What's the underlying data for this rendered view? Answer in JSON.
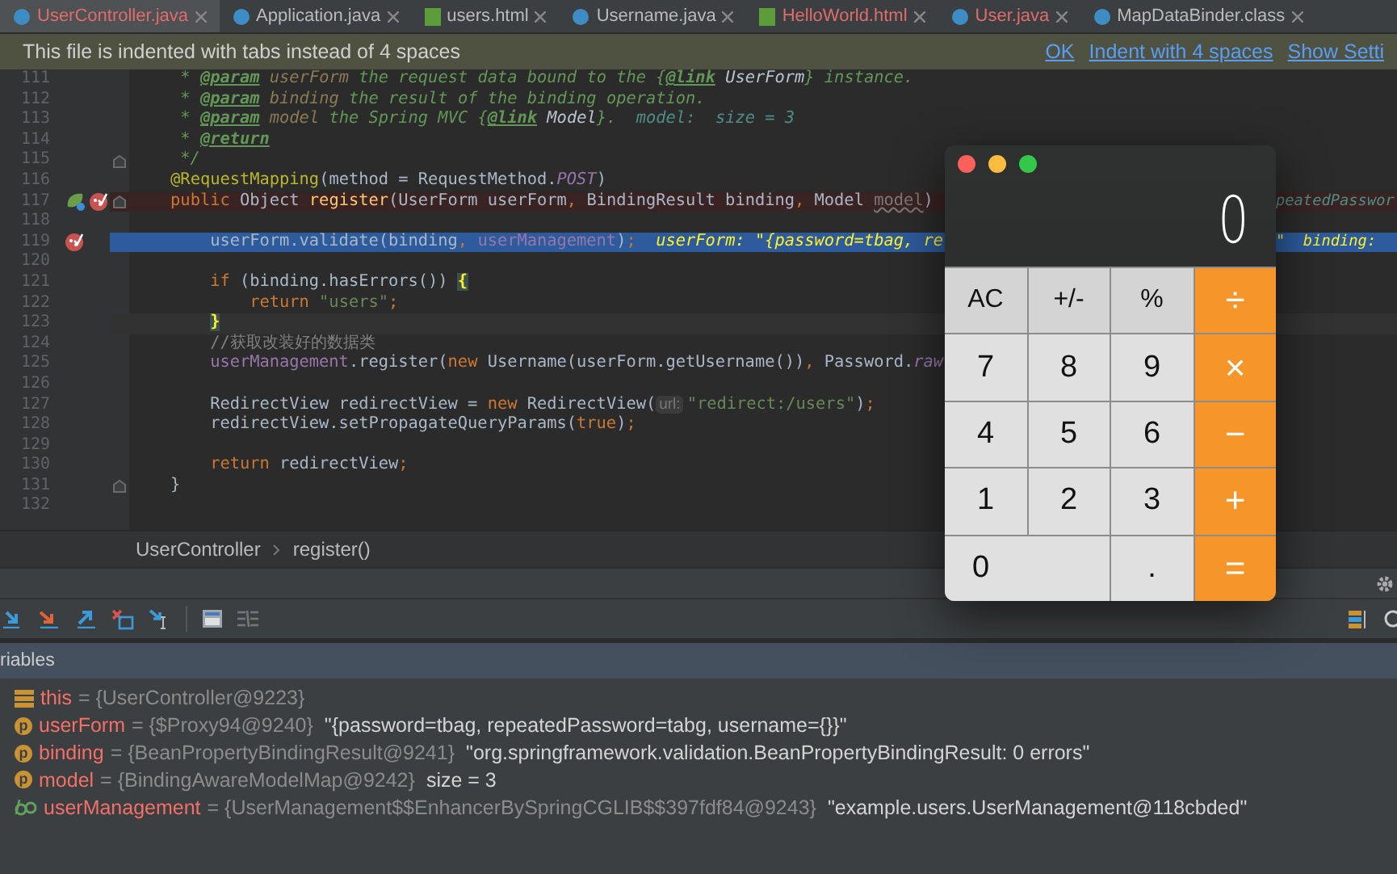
{
  "tabs": [
    {
      "label": "UserController.java",
      "kind": "class",
      "error": true,
      "selected": true
    },
    {
      "label": "Application.java",
      "kind": "class",
      "error": false,
      "selected": false
    },
    {
      "label": "users.html",
      "kind": "html",
      "error": false,
      "selected": false
    },
    {
      "label": "Username.java",
      "kind": "class",
      "error": false,
      "selected": false
    },
    {
      "label": "HelloWorld.html",
      "kind": "html",
      "error": true,
      "selected": false
    },
    {
      "label": "User.java",
      "kind": "class",
      "error": true,
      "selected": false
    },
    {
      "label": "MapDataBinder.class",
      "kind": "class",
      "error": false,
      "selected": false
    }
  ],
  "notification": {
    "message": "This file is indented with tabs instead of 4 spaces",
    "links": [
      "OK",
      "Indent with 4 spaces",
      "Show Setti"
    ]
  },
  "editor": {
    "lines": [
      {
        "number": "111",
        "kind": "plain",
        "tokens": [
          {
            "text": "     * ",
            "kind": "doc"
          },
          {
            "text": "@param",
            "kind": "doctag"
          },
          {
            "text": " userForm",
            "kind": "docparam"
          },
          {
            "text": " the request data bound to the {",
            "kind": "doc"
          },
          {
            "text": "@link",
            "kind": "doctag"
          },
          {
            "text": " UserForm",
            "kind": "docref"
          },
          {
            "text": "} instance.",
            "kind": "doc"
          }
        ]
      },
      {
        "number": "112",
        "kind": "plain",
        "tokens": [
          {
            "text": "     * ",
            "kind": "doc"
          },
          {
            "text": "@param",
            "kind": "doctag"
          },
          {
            "text": " binding",
            "kind": "docparam"
          },
          {
            "text": " the result of the binding operation.",
            "kind": "doc"
          }
        ]
      },
      {
        "number": "113",
        "kind": "plain",
        "tokens": [
          {
            "text": "     * ",
            "kind": "doc"
          },
          {
            "text": "@param",
            "kind": "doctag"
          },
          {
            "text": " model",
            "kind": "docparam"
          },
          {
            "text": " the Spring MVC {",
            "kind": "doc"
          },
          {
            "text": "@link",
            "kind": "doctag"
          },
          {
            "text": " Model",
            "kind": "docref"
          },
          {
            "text": "}.",
            "kind": "doc"
          },
          {
            "text": "  model:  size = 3",
            "kind": "hint"
          }
        ]
      },
      {
        "number": "114",
        "kind": "plain",
        "tokens": [
          {
            "text": "     * ",
            "kind": "doc"
          },
          {
            "text": "@return",
            "kind": "doctag"
          }
        ]
      },
      {
        "number": "115",
        "kind": "plain",
        "gutter": [
          {
            "kind": "fold"
          }
        ],
        "tokens": [
          {
            "text": "     */",
            "kind": "doc"
          }
        ]
      },
      {
        "number": "116",
        "kind": "plain",
        "tokens": [
          {
            "text": "    @RequestMapping",
            "kind": "ann"
          },
          {
            "text": "(method = RequestMethod.",
            "kind": "plain"
          },
          {
            "text": "POST",
            "kind": "const"
          },
          {
            "text": ")",
            "kind": "plain"
          }
        ]
      },
      {
        "number": "117",
        "kind": "breakpoint",
        "gutter": [
          {
            "kind": "bean"
          },
          {
            "kind": "breakpoint"
          },
          {
            "kind": "fold"
          }
        ],
        "tokens": [
          {
            "text": "    public ",
            "kind": "kw"
          },
          {
            "text": "Object ",
            "kind": "plain"
          },
          {
            "text": "register",
            "kind": "method"
          },
          {
            "text": "(UserForm userForm",
            "kind": "plain"
          },
          {
            "text": ", ",
            "kind": "kw"
          },
          {
            "text": "BindingResult binding",
            "kind": "plain"
          },
          {
            "text": ", ",
            "kind": "kw"
          },
          {
            "text": "Model ",
            "kind": "plain"
          },
          {
            "text": "model",
            "kind": "unused"
          },
          {
            "text": ")",
            "kind": "plain"
          }
        ],
        "right": [
          {
            "text": "peatedPasswor",
            "kind": "hint"
          }
        ]
      },
      {
        "number": "118",
        "kind": "plain"
      },
      {
        "number": "119",
        "kind": "execution",
        "gutter": [
          {
            "kind": "breakpoint"
          }
        ],
        "tokens": [
          {
            "text": "        userForm.validate(binding",
            "kind": "plain"
          },
          {
            "text": ", ",
            "kind": "kw"
          },
          {
            "text": "userManagement",
            "kind": "field"
          },
          {
            "text": ")",
            "kind": "plain"
          },
          {
            "text": ";",
            "kind": "kw"
          },
          {
            "text": "  userForm: \"{password=tbag, re",
            "kind": "debughint"
          }
        ],
        "right": [
          {
            "text": "\"  binding: ",
            "kind": "debughint"
          }
        ]
      },
      {
        "number": "120",
        "kind": "plain"
      },
      {
        "number": "121",
        "kind": "plain",
        "tokens": [
          {
            "text": "        if ",
            "kind": "kw"
          },
          {
            "text": "(binding.hasErrors()) ",
            "kind": "plain"
          },
          {
            "text": "{",
            "kind": "brace"
          }
        ]
      },
      {
        "number": "122",
        "kind": "plain",
        "tokens": [
          {
            "text": "            return ",
            "kind": "kw"
          },
          {
            "text": "\"users\"",
            "kind": "str"
          },
          {
            "text": ";",
            "kind": "kw"
          }
        ]
      },
      {
        "number": "123",
        "kind": "caret",
        "tokens": [
          {
            "text": "        }",
            "kind": "brace"
          }
        ]
      },
      {
        "number": "124",
        "kind": "plain",
        "tokens": [
          {
            "text": "        //获取改装好的数据类",
            "kind": "comment"
          }
        ]
      },
      {
        "number": "125",
        "kind": "plain",
        "tokens": [
          {
            "text": "        userManagement",
            "kind": "field"
          },
          {
            "text": ".register(",
            "kind": "plain"
          },
          {
            "text": "new ",
            "kind": "kw"
          },
          {
            "text": "Username(userForm.getUsername())",
            "kind": "plain"
          },
          {
            "text": ", ",
            "kind": "kw"
          },
          {
            "text": "Password.",
            "kind": "plain"
          },
          {
            "text": "raw",
            "kind": "const"
          }
        ]
      },
      {
        "number": "126",
        "kind": "plain"
      },
      {
        "number": "127",
        "kind": "plain",
        "tokens": [
          {
            "text": "        RedirectView redirectView = ",
            "kind": "plain"
          },
          {
            "text": "new ",
            "kind": "kw"
          },
          {
            "text": "RedirectView(",
            "kind": "plain"
          },
          {
            "text": "url:",
            "kind": "paramhint"
          },
          {
            "text": "\"redirect:/users\"",
            "kind": "str"
          },
          {
            "text": ")",
            "kind": "plain"
          },
          {
            "text": ";",
            "kind": "kw"
          }
        ]
      },
      {
        "number": "128",
        "kind": "plain",
        "tokens": [
          {
            "text": "        redirectView.setPropagateQueryParams(",
            "kind": "plain"
          },
          {
            "text": "true",
            "kind": "kw"
          },
          {
            "text": ")",
            "kind": "plain"
          },
          {
            "text": ";",
            "kind": "kw"
          }
        ]
      },
      {
        "number": "129",
        "kind": "plain"
      },
      {
        "number": "130",
        "kind": "plain",
        "tokens": [
          {
            "text": "        return ",
            "kind": "kw"
          },
          {
            "text": "redirectView",
            "kind": "plain"
          },
          {
            "text": ";",
            "kind": "kw"
          }
        ]
      },
      {
        "number": "131",
        "kind": "plain",
        "gutter": [
          {
            "kind": "fold"
          }
        ],
        "tokens": [
          {
            "text": "    }",
            "kind": "plain"
          }
        ]
      },
      {
        "number": "132",
        "kind": "plain"
      }
    ]
  },
  "breadcrumb": [
    "UserController",
    "register()"
  ],
  "debugger": {
    "panel_title": "riables",
    "variables": [
      {
        "kind": "fields",
        "name": "this",
        "type": "= {UserController@9223}"
      },
      {
        "kind": "param",
        "badge": "p",
        "name": "userForm",
        "type": "= {$Proxy94@9240}",
        "value": "\"{password=tbag, repeatedPassword=tabg, username={}}\""
      },
      {
        "kind": "param",
        "badge": "p",
        "name": "binding",
        "type": "= {BeanPropertyBindingResult@9241}",
        "value": "\"org.springframework.validation.BeanPropertyBindingResult: 0 errors\""
      },
      {
        "kind": "param",
        "badge": "p",
        "name": "model",
        "type": "= {BindingAwareModelMap@9242}",
        "value": "size = 3"
      },
      {
        "kind": "watch",
        "name": "userManagement",
        "type": "= {UserManagement$$EnhancerBySpringCGLIB$$397fdf84@9243}",
        "value": "\"example.users.UserManagement@118cbded\""
      }
    ]
  },
  "calculator": {
    "display": "0",
    "buttons": [
      {
        "label": "AC",
        "kind": "function",
        "wide": false
      },
      {
        "label": "+/-",
        "kind": "function",
        "wide": false
      },
      {
        "label": "%",
        "kind": "function",
        "wide": false
      },
      {
        "label": "÷",
        "kind": "operator",
        "wide": false
      },
      {
        "label": "7",
        "kind": "digit",
        "wide": false
      },
      {
        "label": "8",
        "kind": "digit",
        "wide": false
      },
      {
        "label": "9",
        "kind": "digit",
        "wide": false
      },
      {
        "label": "×",
        "kind": "operator",
        "wide": false
      },
      {
        "label": "4",
        "kind": "digit",
        "wide": false
      },
      {
        "label": "5",
        "kind": "digit",
        "wide": false
      },
      {
        "label": "6",
        "kind": "digit",
        "wide": false
      },
      {
        "label": "−",
        "kind": "operator",
        "wide": false
      },
      {
        "label": "1",
        "kind": "digit",
        "wide": false
      },
      {
        "label": "2",
        "kind": "digit",
        "wide": false
      },
      {
        "label": "3",
        "kind": "digit",
        "wide": false
      },
      {
        "label": "+",
        "kind": "operator",
        "wide": false
      },
      {
        "label": "0",
        "kind": "digit",
        "wide": true
      },
      {
        "label": ".",
        "kind": "digit",
        "wide": false
      },
      {
        "label": "=",
        "kind": "operator",
        "wide": false
      }
    ]
  }
}
